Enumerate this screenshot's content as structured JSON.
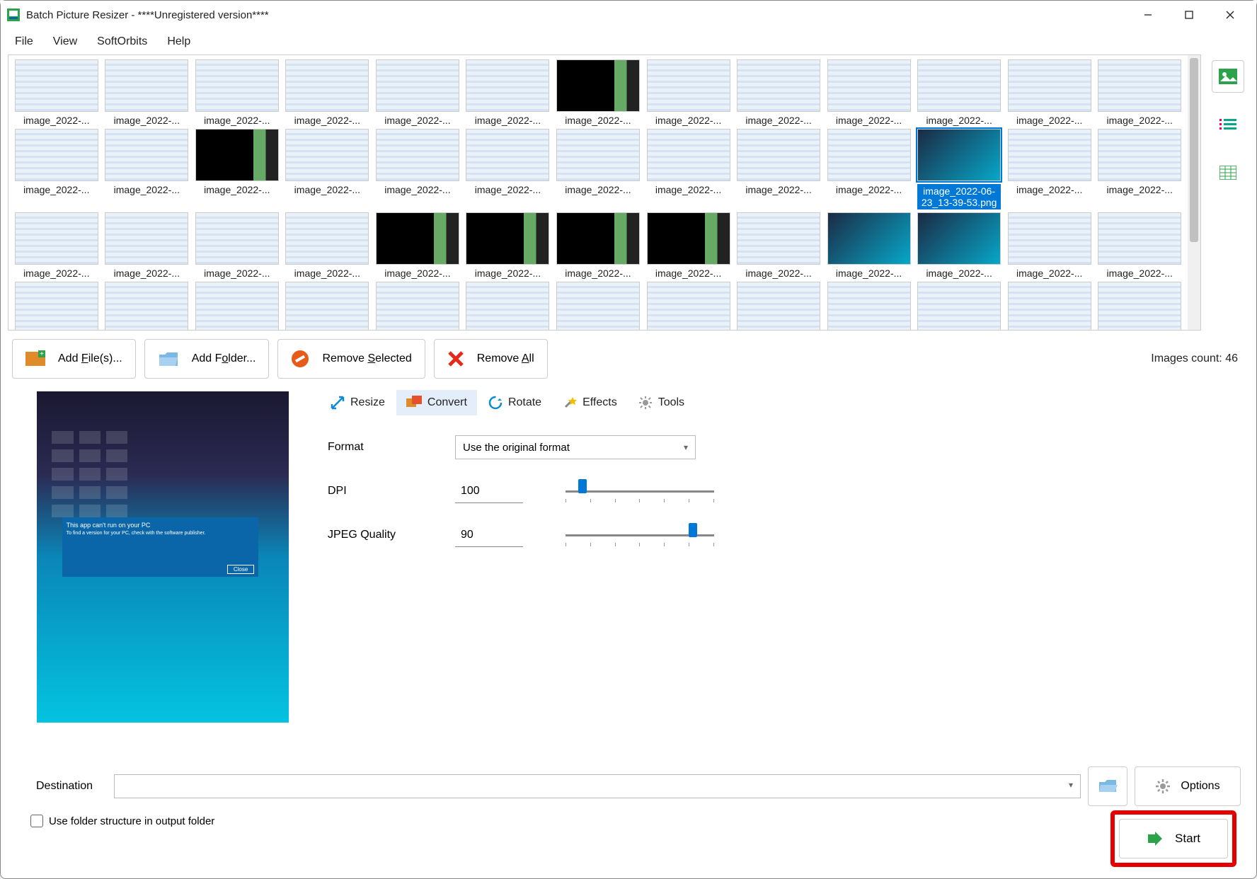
{
  "titlebar": {
    "title": "Batch Picture Resizer - ****Unregistered version****"
  },
  "menu": {
    "file": "File",
    "view": "View",
    "softorbits": "SoftOrbits",
    "help": "Help"
  },
  "thumbnails": {
    "generic_label": "image_2022-...",
    "selected_label": "image_2022-06-23_13-39-53.png"
  },
  "actions": {
    "add_files": "Add File(s)...",
    "add_folder": "Add Folder...",
    "remove_selected": "Remove Selected",
    "remove_all": "Remove All",
    "images_count": "Images count: 46"
  },
  "tabs": {
    "resize": "Resize",
    "convert": "Convert",
    "rotate": "Rotate",
    "effects": "Effects",
    "tools": "Tools"
  },
  "form": {
    "format_label": "Format",
    "format_value": "Use the original format",
    "dpi_label": "DPI",
    "dpi_value": "100",
    "jpeg_label": "JPEG Quality",
    "jpeg_value": "90"
  },
  "destination": {
    "label": "Destination",
    "value": "",
    "options_label": "Options",
    "use_folder_structure": "Use folder structure in output folder",
    "start_label": "Start"
  },
  "sliders": {
    "dpi_percent": 12,
    "jpeg_percent": 90
  }
}
